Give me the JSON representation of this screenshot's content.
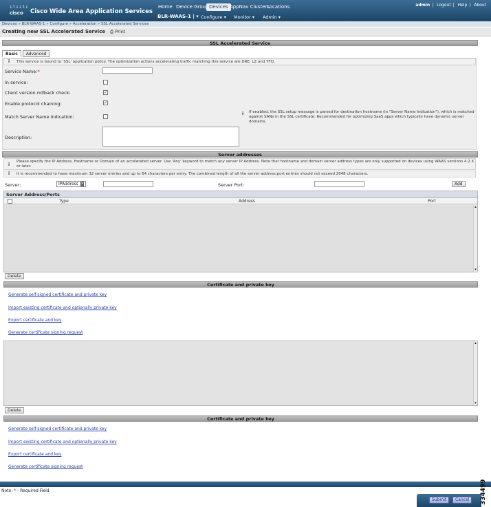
{
  "header": {
    "logo_bars": "ılıılı",
    "logo_word": "cisco",
    "app_title": "Cisco Wide Area Application Services",
    "nav_tabs": [
      "Home",
      "Device Groups",
      "Devices",
      "AppNav Clusters",
      "Locations"
    ],
    "active_tab": "Devices",
    "user_links": [
      "admin",
      "Logout",
      "Help",
      "About"
    ],
    "device_name": "BLR-WAAS-1 | ▾",
    "sub_menu": [
      "Configure ▾",
      "Monitor ▾",
      "Admin ▾"
    ],
    "breadcrumb": "Devices » BLR-WAAS-1 » Configure » Acceleration » SSL Accelerated Services"
  },
  "page": {
    "title": "Creating new SSL Accelerated Service",
    "print_label": "Print"
  },
  "ssl_section": {
    "title": "SSL Accelerated Service",
    "tabs": [
      "Basic",
      "Advanced"
    ],
    "info": "This service is bound to 'SSL' application policy. The optimization actions accelerating traffic matching this service are DRE, LZ and TFO.",
    "service_name_label": "Service Name:",
    "required_mark": "*",
    "in_service_label": "In service:",
    "rollback_label": "Client version rollback check:",
    "chaining_label": "Enable protocol chaining:",
    "sni_label": "Match Server Name Indication:",
    "sni_note": "If enabled, the SSL setup message is parsed for destination hostname (in \"Server Name Indication\"), which is matched against SANs in the SSL certificate. Recommended for optimizing SaaS apps which typically have dynamic server domains.",
    "description_label": "Description:",
    "checkbox_mark": "✓"
  },
  "server_section": {
    "title": "Server addresses",
    "info1": "Please specify the IP Address, Hostname or Domain of an accelerated server. Use 'Any' keyword to match any server IP Address. Note that hostname and domain server address types are only supported on devices using WAAS versions 4.2.X or later.",
    "info2": "It is recommended to have maximum 32 server entries and up to 64 characters per entry. The combined length of all the server address:port entries should not exceed 2048 characters.",
    "server_label": "Server:",
    "server_type": "IPAddress",
    "port_label": "Server Port:",
    "add_label": "Add",
    "table_title": "Server Address/Ports",
    "columns": [
      "Type",
      "Address",
      "Port"
    ],
    "delete_label": "Delete"
  },
  "cert_section_1": {
    "title": "Certificate and private key",
    "links": [
      "Generate self-signed certificate and private key",
      "Import existing certificate and optionally private key",
      "Export certificate and key",
      "Generate certificate signing request"
    ],
    "delete_label": "Delete"
  },
  "cert_section_2": {
    "title": "Certificate and private key",
    "links": [
      "Generate self-signed certificate and private key",
      "Import existing certificate and optionally private key",
      "Export certificate and key",
      "Generate certificate signing request"
    ]
  },
  "footer": {
    "note_prefix": "Note:",
    "required_mark": "*",
    "note_suffix": "- Required Field",
    "submit": "Submit",
    "cancel": "Cancel",
    "figure_id": "334499"
  }
}
